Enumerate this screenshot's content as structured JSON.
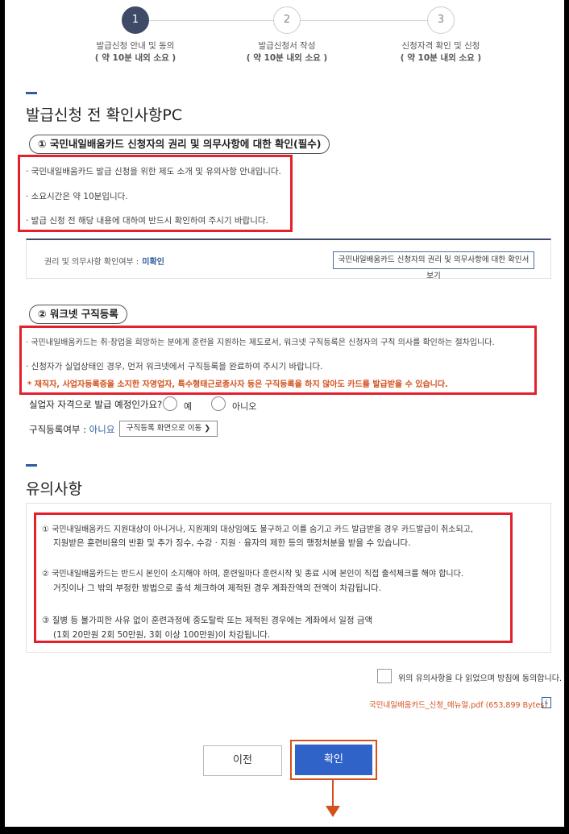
{
  "steps": [
    {
      "num": "1",
      "label": "발급신청 안내 및 동의",
      "sub": "( 약 10분 내외 소요 )"
    },
    {
      "num": "2",
      "label": "발급신청서 작성",
      "sub": "( 약 10분 내외 소요 )"
    },
    {
      "num": "3",
      "label": "신청자격 확인 및 신청",
      "sub": "( 약 10분 내외 소요 )"
    }
  ],
  "section1": {
    "title": "발급신청 전 확인사항PC",
    "rights": {
      "pill": "① 국민내일배움카드 신청자의 권리 및 의무사항에 대한 확인(필수)",
      "bullets": [
        "· 국민내일배움카드 발급 신청을 위한 제도 소개 및 유의사항 안내입니다.",
        "· 소요시간은 약 10분입니다.",
        "· 발급 신청 전 해당 내용에 대하여 반드시 확인하여 주시기 바랍니다."
      ],
      "check_label": "권리 및 의무사항 확인여부 :",
      "check_value": "미확인",
      "view_button": "국민내일배움카드 신청자의 권리 및 의무사항에 대한 확인서 보기"
    },
    "worknet": {
      "pill": "② 워크넷 구직등록",
      "bullets": [
        "· 국민내일배움카드는 취·창업을 희망하는 분에게 훈련을 지원하는 제도로서, 워크넷 구직등록은 신청자의 구직 의사를 확인하는 절차입니다.",
        "· 신청자가 실업상태인 경우, 먼저 워크넷에서 구직등록을 완료하여 주시기 바랍니다."
      ],
      "note": "* 재직자, 사업자등록증을 소지한 자영업자, 특수형태근로종사자 등은 구직등록을 하지 않아도 카드를 발급받을 수 있습니다.",
      "question": "실업자 자격으로 발급 예정인가요?",
      "yes": "예",
      "no": "아니오",
      "jobreg_label": "구직등록여부 :",
      "jobreg_value": "아니요",
      "jobreg_button": "구직등록 화면으로 이동 ❯"
    }
  },
  "section2": {
    "title": "유의사항",
    "items": [
      [
        "① 국민내일배움카드 지원대상이 아니거나, 지원제외 대상임에도 불구하고 이를 숨기고 카드 발급받을 경우 카드발급이 취소되고,",
        "지원받은 훈련비용의 반환 및 추가 징수, 수강 · 지원 · 융자의 제한 등의 행정처분을 받을 수 있습니다."
      ],
      [
        "② 국민내일배움카드는 반드시 본인이 소지해야 하며, 훈련일마다 훈련시작 및 종료 시에 본인이 직접 출석체크를 해야 합니다.",
        "거짓이나 그 밖의 부정한 방법으로 출석 체크하여 제적된 경우 계좌잔액의 전액이 차감됩니다."
      ],
      [
        "③ 질병 등 불가피한 사유 없이 훈련과정에 중도탈락 또는 제적된 경우에는 계좌에서 일정 금액",
        "(1회 20만원 2회 50만원, 3회 이상 100만원)이 차감됩니다."
      ]
    ],
    "agree_label": "위의 유의사항을 다 읽었으며 방침에 동의합니다.",
    "pdf": "국민내일배움카드_신청_매뉴얼.pdf (653,899 Bytes)"
  },
  "buttons": {
    "prev": "이전",
    "confirm": "확인"
  },
  "colors": {
    "accent": "#2f63c8",
    "highlight": "#e3202b",
    "orange": "#d4501c",
    "step_active": "#3e4a66"
  }
}
